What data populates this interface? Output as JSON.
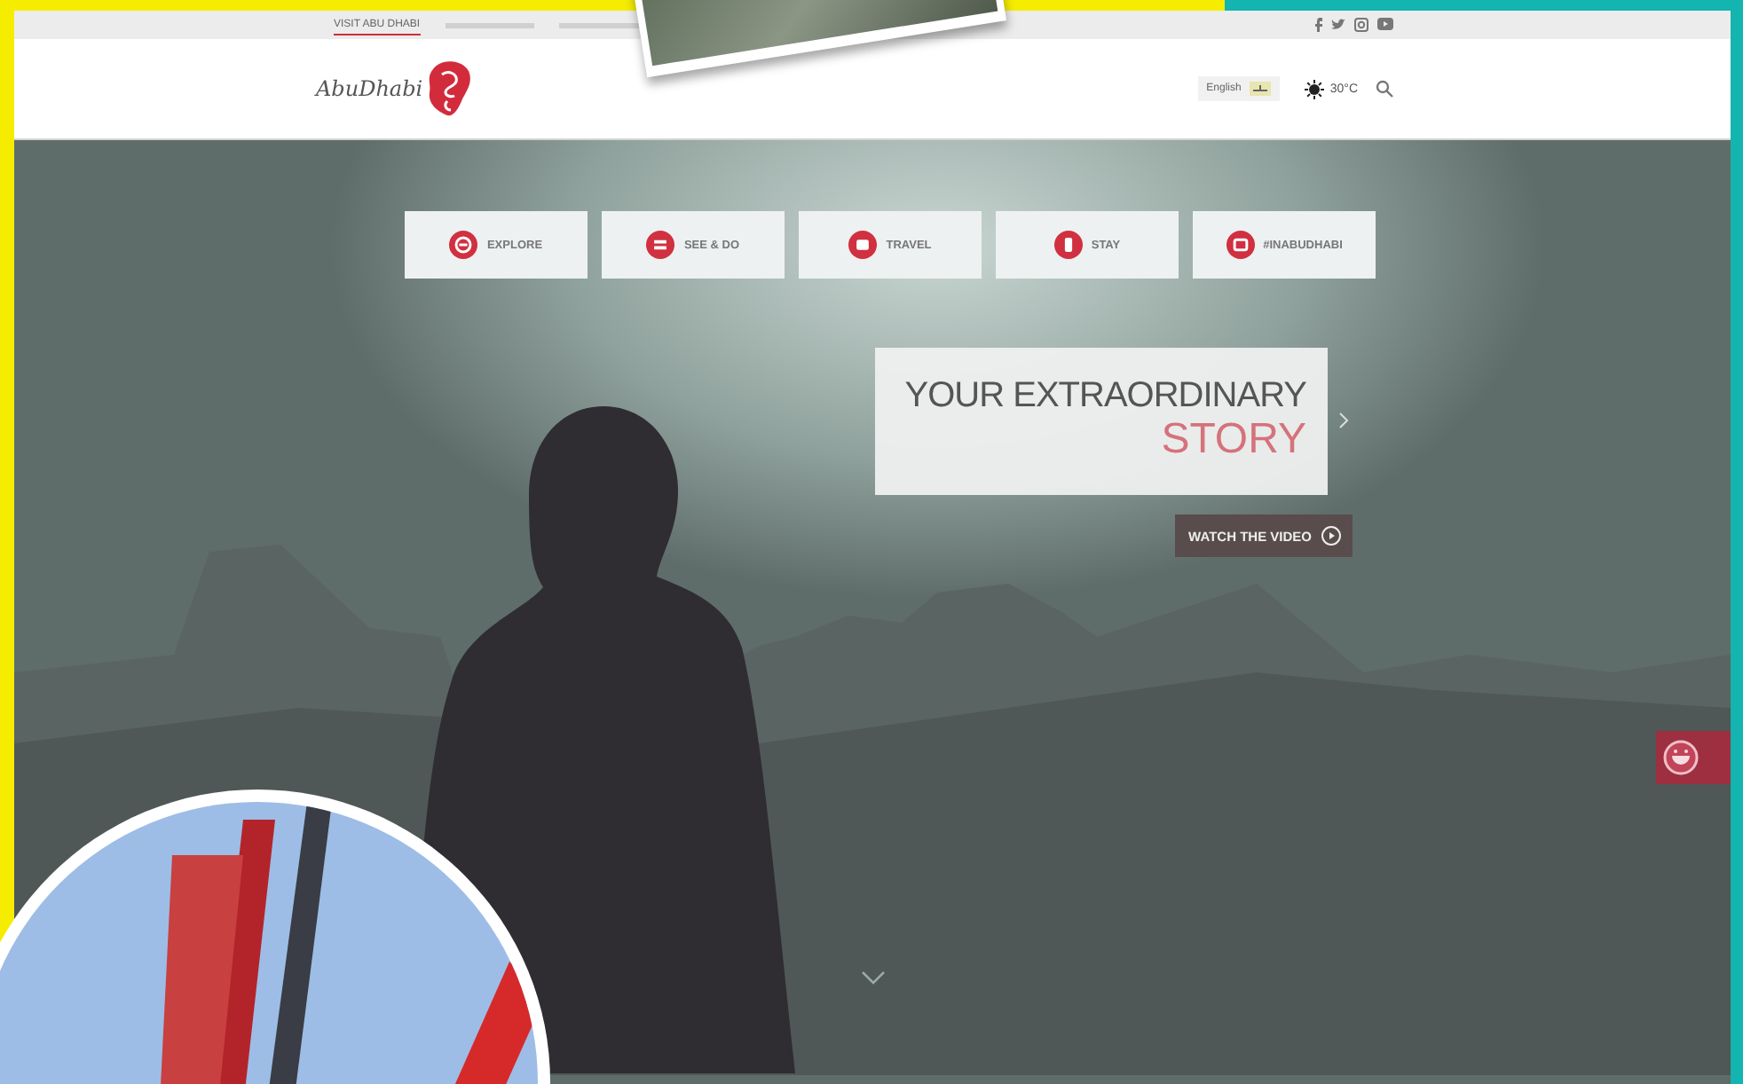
{
  "top_bar": {
    "tabs": [
      {
        "label": "VISIT ABU DHABI",
        "selected": true
      }
    ]
  },
  "header": {
    "logo_text": "AbuDhabi",
    "language": "English",
    "temperature": "30°C"
  },
  "hero": {
    "nav": [
      {
        "label": "EXPLORE"
      },
      {
        "label": "SEE & DO"
      },
      {
        "label": "TRAVEL"
      },
      {
        "label": "STAY"
      },
      {
        "label": "#INABUDHABI"
      }
    ],
    "headline": "YOUR EXTRAORDINARY",
    "headline_accent": "STORY",
    "video_button": "WATCH THE VIDEO"
  }
}
